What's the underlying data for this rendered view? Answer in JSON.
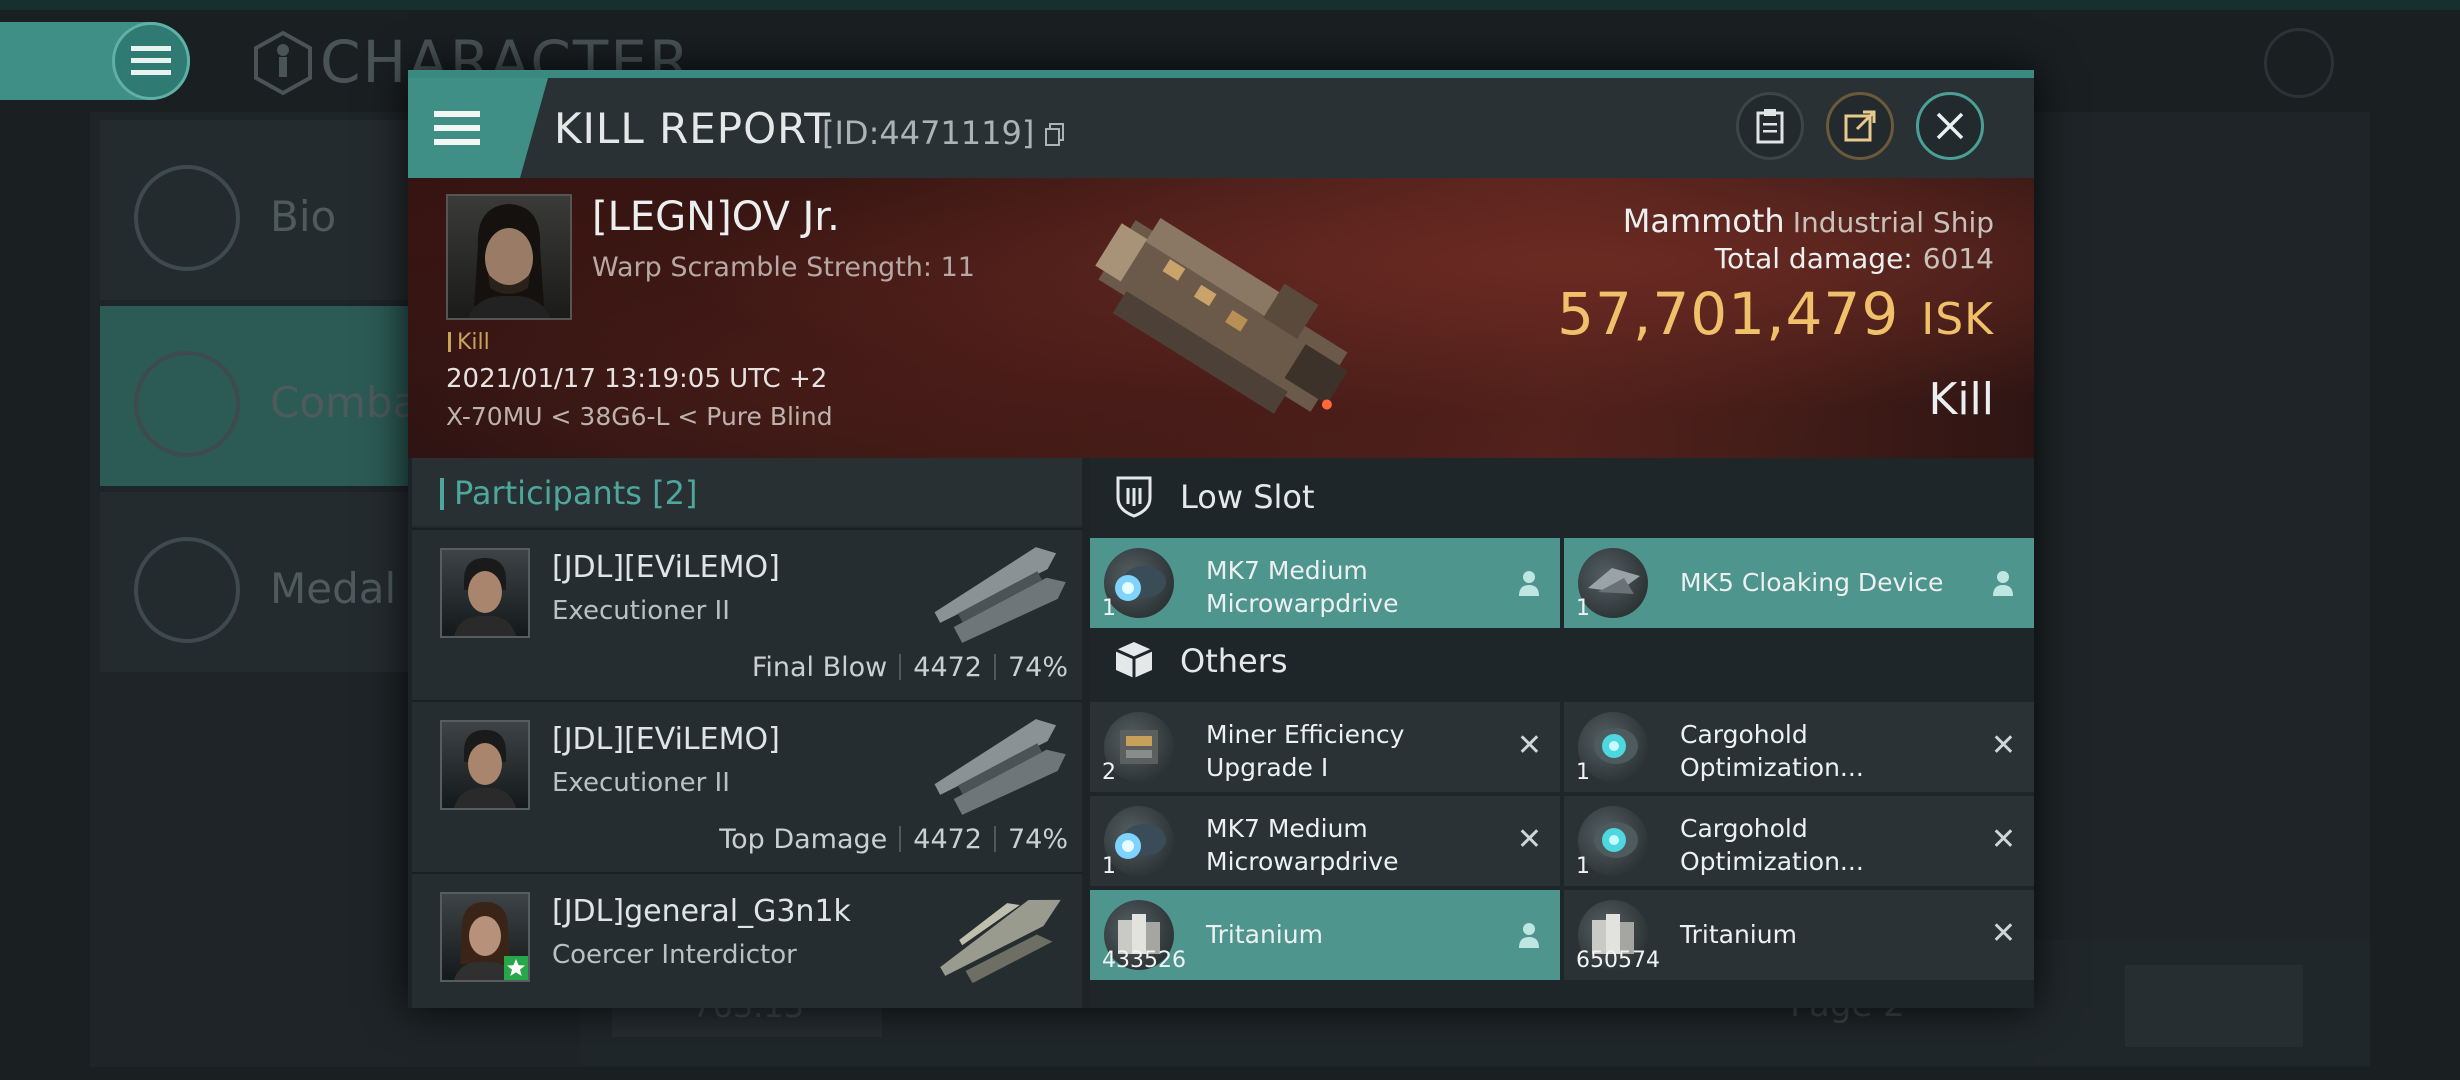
{
  "background": {
    "title": "CHARACTER",
    "sidebar": [
      {
        "label": "Bio"
      },
      {
        "label": "Combat"
      },
      {
        "label": "Medal"
      }
    ],
    "list_value": "763.13",
    "pager": "Page 2"
  },
  "report": {
    "title": "KILL REPORT",
    "id_text": "[ID:4471119]",
    "victim": {
      "name": "[LEGN]OV Jr.",
      "warp": "Warp Scramble Strength: 11",
      "kill_tag": "Kill",
      "timestamp": "2021/01/17 13:19:05 UTC +2",
      "location": "X-70MU < 38G6-L < Pure Blind"
    },
    "ship": {
      "name": "Mammoth",
      "class": "Industrial Ship",
      "total_damage_label": "Total damage:",
      "total_damage": "6014",
      "isk_value": "57,701,479",
      "isk_unit": "ISK",
      "result": "Kill"
    },
    "participants_title": "Participants",
    "participants_count": "[2]",
    "participants": [
      {
        "name": "[JDL][EViLEMO]",
        "ship": "Executioner II",
        "label": "Final Blow",
        "damage": "4472",
        "percent": "74%"
      },
      {
        "name": "[JDL][EViLEMO]",
        "ship": "Executioner II",
        "label": "Top Damage",
        "damage": "4472",
        "percent": "74%"
      },
      {
        "name": "[JDL]general_G3n1k",
        "ship": "Coercer Interdictor",
        "label": "",
        "damage": "",
        "percent": ""
      }
    ],
    "low_slot_title": "Low Slot",
    "low_slot": [
      {
        "qty": "1",
        "name": "MK7 Medium Microwarpdrive"
      },
      {
        "qty": "1",
        "name": "MK5 Cloaking Device"
      }
    ],
    "others_title": "Others",
    "others": [
      {
        "qty": "2",
        "name": "Miner Efficiency Upgrade I"
      },
      {
        "qty": "1",
        "name": "Cargohold Optimization..."
      },
      {
        "qty": "1",
        "name": "MK7 Medium Microwarpdrive"
      },
      {
        "qty": "1",
        "name": "Cargohold Optimization..."
      },
      {
        "qty": "433526",
        "name": "Tritanium"
      },
      {
        "qty": "650574",
        "name": "Tritanium"
      }
    ]
  },
  "colors": {
    "accent": "#4e958d",
    "isk": "#f0c06a",
    "banner": "#55231d"
  }
}
